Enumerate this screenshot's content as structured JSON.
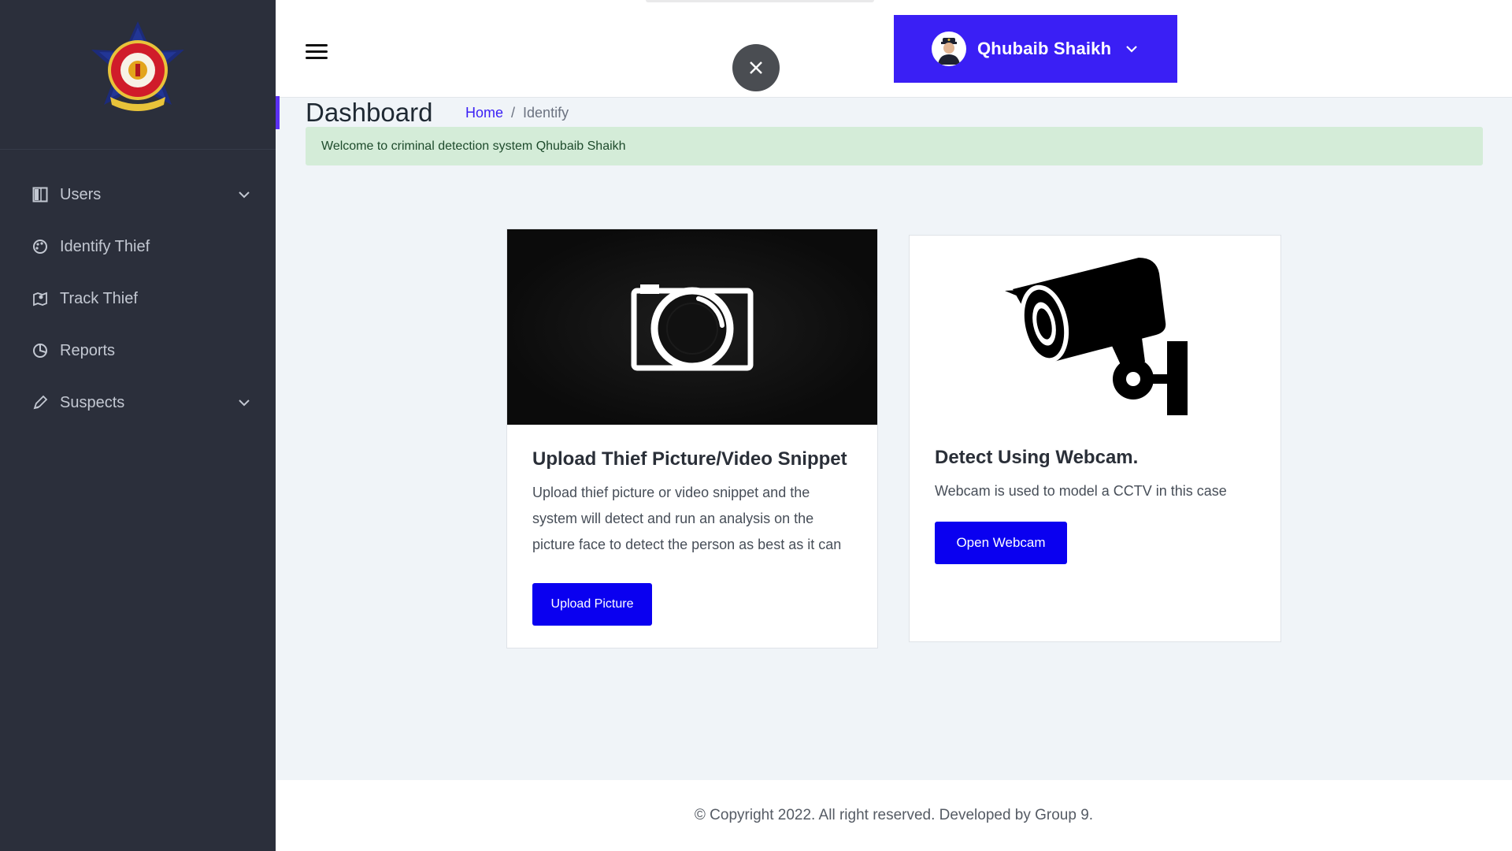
{
  "sidebar": {
    "items": [
      {
        "label": "Users",
        "icon": "columns-icon",
        "has_submenu": true
      },
      {
        "label": "Identify Thief",
        "icon": "palette-icon",
        "has_submenu": false
      },
      {
        "label": "Track Thief",
        "icon": "map-icon",
        "has_submenu": false
      },
      {
        "label": "Reports",
        "icon": "pie-chart-icon",
        "has_submenu": false
      },
      {
        "label": "Suspects",
        "icon": "pen-icon",
        "has_submenu": true
      }
    ]
  },
  "header": {
    "user_name": "Qhubaib Shaikh",
    "accent_color": "#3a1ff5"
  },
  "page": {
    "title": "Dashboard",
    "breadcrumb": {
      "home": "Home",
      "separator": "/",
      "current": "Identify"
    },
    "alert": "Welcome to criminal detection system Qhubaib Shaikh"
  },
  "cards": {
    "upload": {
      "title": "Upload Thief Picture/Video Snippet",
      "text": "Upload thief picture or video snippet and the system will detect and run an analysis on the picture face to detect the person as best as it can",
      "button": "Upload Picture"
    },
    "webcam": {
      "title": "Detect Using Webcam.",
      "text": "Webcam is used to model a CCTV in this case",
      "button": "Open Webcam"
    }
  },
  "footer": {
    "text": "© Copyright 2022. All right reserved. Developed by Group 9."
  }
}
